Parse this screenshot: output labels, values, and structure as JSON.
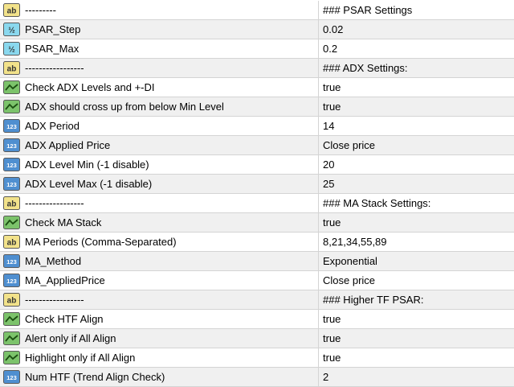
{
  "parameters": [
    {
      "icon": "string-icon",
      "name": "---------",
      "value": "### PSAR Settings"
    },
    {
      "icon": "double-icon",
      "name": "PSAR_Step",
      "value": "0.02"
    },
    {
      "icon": "double-icon",
      "name": "PSAR_Max",
      "value": "0.2"
    },
    {
      "icon": "string-icon",
      "name": "-----------------",
      "value": "### ADX Settings:"
    },
    {
      "icon": "bool-icon",
      "name": "Check ADX Levels and +-DI",
      "value": "true"
    },
    {
      "icon": "bool-icon",
      "name": "ADX should cross up from below Min Level",
      "value": "true"
    },
    {
      "icon": "int-icon",
      "name": "ADX Period",
      "value": "14"
    },
    {
      "icon": "int-icon",
      "name": "ADX Applied Price",
      "value": "Close price"
    },
    {
      "icon": "int-icon",
      "name": "ADX Level Min (-1 disable)",
      "value": "20"
    },
    {
      "icon": "int-icon",
      "name": "ADX Level Max (-1 disable)",
      "value": "25"
    },
    {
      "icon": "string-icon",
      "name": "-----------------",
      "value": "### MA Stack Settings:"
    },
    {
      "icon": "bool-icon",
      "name": "Check MA Stack",
      "value": "true"
    },
    {
      "icon": "string-icon",
      "name": "MA Periods (Comma-Separated)",
      "value": "8,21,34,55,89"
    },
    {
      "icon": "int-icon",
      "name": "MA_Method",
      "value": "Exponential"
    },
    {
      "icon": "int-icon",
      "name": "MA_AppliedPrice",
      "value": "Close price"
    },
    {
      "icon": "string-icon",
      "name": "-----------------",
      "value": "### Higher TF PSAR:"
    },
    {
      "icon": "bool-icon",
      "name": "Check HTF Align",
      "value": "true"
    },
    {
      "icon": "bool-icon",
      "name": "Alert only if All Align",
      "value": "true"
    },
    {
      "icon": "bool-icon",
      "name": "Highlight only if All Align",
      "value": "true"
    },
    {
      "icon": "int-icon",
      "name": "Num HTF (Trend Align Check)",
      "value": "2"
    }
  ],
  "icon_text": {
    "string-icon": "ab",
    "double-icon": "½",
    "int-icon": "123"
  },
  "colors": {
    "string_icon_fill": "#f2e28a",
    "double_icon_fill": "#8ad8ee",
    "int_icon_fill": "#4f8fd0",
    "bool_icon_fill": "#7cc36b",
    "row_alt": "#f0f0f0",
    "grid_line": "#d4d4d4"
  }
}
